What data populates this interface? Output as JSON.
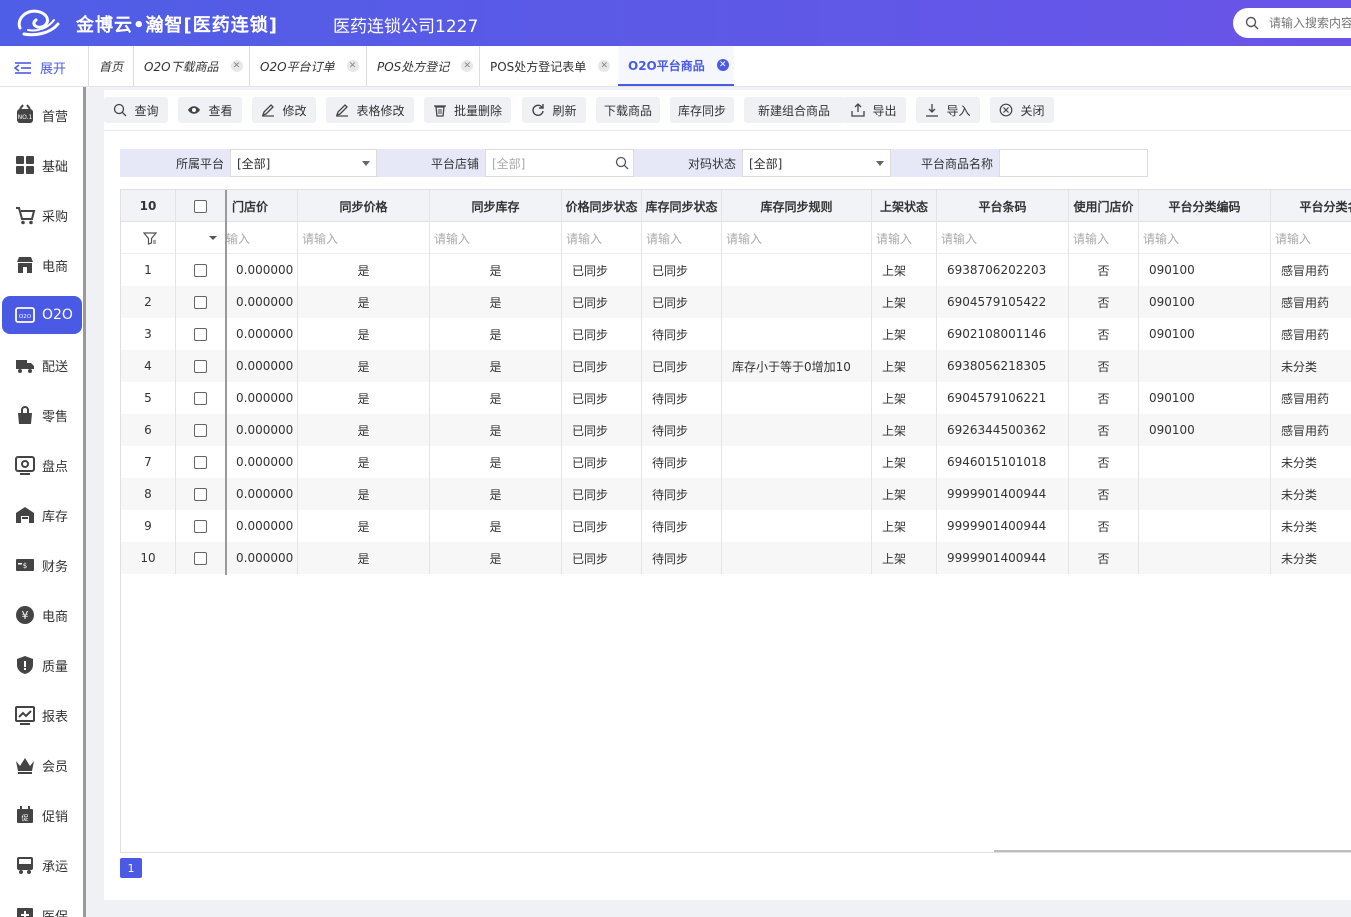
{
  "header": {
    "brand": "金博云•瀚智[医药连锁]",
    "company": "医药连锁公司1227",
    "search_placeholder": "请输入搜索内容"
  },
  "tabbar": {
    "expand_label": "展开",
    "tabs": [
      {
        "label": "首页",
        "closable": false
      },
      {
        "label": "O2O下载商品",
        "closable": true
      },
      {
        "label": "O2O平台订单",
        "closable": true
      },
      {
        "label": "POS处方登记",
        "closable": true
      },
      {
        "label": "POS处方登记表单",
        "closable": true
      },
      {
        "label": "O2O平台商品",
        "closable": true,
        "active": true
      }
    ]
  },
  "sidebar": {
    "items": [
      {
        "label": "首营",
        "icon": "medal-icon"
      },
      {
        "label": "基础",
        "icon": "grid-icon"
      },
      {
        "label": "采购",
        "icon": "cart-icon"
      },
      {
        "label": "电商",
        "icon": "shop-icon"
      },
      {
        "label": "O2O",
        "icon": "o2o-icon",
        "active": true
      },
      {
        "label": "配送",
        "icon": "truck-icon"
      },
      {
        "label": "零售",
        "icon": "bag-icon"
      },
      {
        "label": "盘点",
        "icon": "inventory-check-icon"
      },
      {
        "label": "库存",
        "icon": "warehouse-icon"
      },
      {
        "label": "财务",
        "icon": "finance-icon"
      },
      {
        "label": "电商",
        "icon": "yen-icon"
      },
      {
        "label": "质量",
        "icon": "shield-icon"
      },
      {
        "label": "报表",
        "icon": "chart-icon"
      },
      {
        "label": "会员",
        "icon": "crown-icon"
      },
      {
        "label": "促销",
        "icon": "promo-icon"
      },
      {
        "label": "承运",
        "icon": "bus-icon"
      },
      {
        "label": "医保",
        "icon": "insurance-icon"
      }
    ]
  },
  "toolbar": {
    "buttons": [
      {
        "label": "查询",
        "icon": "search-icon"
      },
      {
        "label": "查看",
        "icon": "eye-icon"
      },
      {
        "label": "修改",
        "icon": "edit-icon"
      },
      {
        "label": "表格修改",
        "icon": "edit-icon"
      },
      {
        "label": "批量删除",
        "icon": "trash-icon"
      },
      {
        "label": "刷新",
        "icon": "refresh-icon"
      },
      {
        "label": "下载商品",
        "icon": ""
      },
      {
        "label": "库存同步",
        "icon": ""
      },
      {
        "label": "新建组合商品",
        "icon": ""
      },
      {
        "label": "导出",
        "icon": "export-icon"
      },
      {
        "label": "导入",
        "icon": "import-icon"
      },
      {
        "label": "关闭",
        "icon": "close-circle-icon"
      }
    ]
  },
  "filters": {
    "platform_label": "所属平台",
    "platform_value": "[全部]",
    "store_label": "平台店铺",
    "store_placeholder": "[全部]",
    "match_label": "对码状态",
    "match_value": "[全部]",
    "name_label": "平台商品名称",
    "name_value": ""
  },
  "grid": {
    "row_count_label": "10",
    "columns": [
      "门店价",
      "同步价格",
      "同步库存",
      "价格同步状态",
      "库存同步状态",
      "库存同步规则",
      "上架状态",
      "平台条码",
      "使用门店价",
      "平台分类编码",
      "平台分类名称"
    ],
    "filter_placeholder": "请输入",
    "filter_placeholder_cut": "输入",
    "rows": [
      {
        "no": "1",
        "price": "0.000000",
        "sync_price": "是",
        "sync_stock": "是",
        "price_status": "已同步",
        "stock_status": "已同步",
        "rule": "",
        "shelf": "上架",
        "barcode": "6938706202203",
        "use_store_price": "否",
        "cat_code": "090100",
        "cat_name": "感冒用药"
      },
      {
        "no": "2",
        "price": "0.000000",
        "sync_price": "是",
        "sync_stock": "是",
        "price_status": "已同步",
        "stock_status": "已同步",
        "rule": "",
        "shelf": "上架",
        "barcode": "6904579105422",
        "use_store_price": "否",
        "cat_code": "090100",
        "cat_name": "感冒用药"
      },
      {
        "no": "3",
        "price": "0.000000",
        "sync_price": "是",
        "sync_stock": "是",
        "price_status": "已同步",
        "stock_status": "待同步",
        "rule": "",
        "shelf": "上架",
        "barcode": "6902108001146",
        "use_store_price": "否",
        "cat_code": "090100",
        "cat_name": "感冒用药"
      },
      {
        "no": "4",
        "price": "0.000000",
        "sync_price": "是",
        "sync_stock": "是",
        "price_status": "已同步",
        "stock_status": "已同步",
        "rule": "库存小于等于0增加10",
        "shelf": "上架",
        "barcode": "6938056218305",
        "use_store_price": "否",
        "cat_code": "",
        "cat_name": "未分类"
      },
      {
        "no": "5",
        "price": "0.000000",
        "sync_price": "是",
        "sync_stock": "是",
        "price_status": "已同步",
        "stock_status": "待同步",
        "rule": "",
        "shelf": "上架",
        "barcode": "6904579106221",
        "use_store_price": "否",
        "cat_code": "090100",
        "cat_name": "感冒用药"
      },
      {
        "no": "6",
        "price": "0.000000",
        "sync_price": "是",
        "sync_stock": "是",
        "price_status": "已同步",
        "stock_status": "待同步",
        "rule": "",
        "shelf": "上架",
        "barcode": "6926344500362",
        "use_store_price": "否",
        "cat_code": "090100",
        "cat_name": "感冒用药"
      },
      {
        "no": "7",
        "price": "0.000000",
        "sync_price": "是",
        "sync_stock": "是",
        "price_status": "已同步",
        "stock_status": "待同步",
        "rule": "",
        "shelf": "上架",
        "barcode": "6946015101018",
        "use_store_price": "否",
        "cat_code": "",
        "cat_name": "未分类"
      },
      {
        "no": "8",
        "price": "0.000000",
        "sync_price": "是",
        "sync_stock": "是",
        "price_status": "已同步",
        "stock_status": "待同步",
        "rule": "",
        "shelf": "上架",
        "barcode": "9999901400944",
        "use_store_price": "否",
        "cat_code": "",
        "cat_name": "未分类"
      },
      {
        "no": "9",
        "price": "0.000000",
        "sync_price": "是",
        "sync_stock": "是",
        "price_status": "已同步",
        "stock_status": "待同步",
        "rule": "",
        "shelf": "上架",
        "barcode": "9999901400944",
        "use_store_price": "否",
        "cat_code": "",
        "cat_name": "未分类"
      },
      {
        "no": "10",
        "price": "0.000000",
        "sync_price": "是",
        "sync_stock": "是",
        "price_status": "已同步",
        "stock_status": "待同步",
        "rule": "",
        "shelf": "上架",
        "barcode": "9999901400944",
        "use_store_price": "否",
        "cat_code": "",
        "cat_name": "未分类"
      }
    ]
  },
  "pager": {
    "current": "1"
  },
  "colors": {
    "accent": "#4a5ae5",
    "header_start": "#4f5ee6",
    "header_end": "#6a54e8"
  }
}
